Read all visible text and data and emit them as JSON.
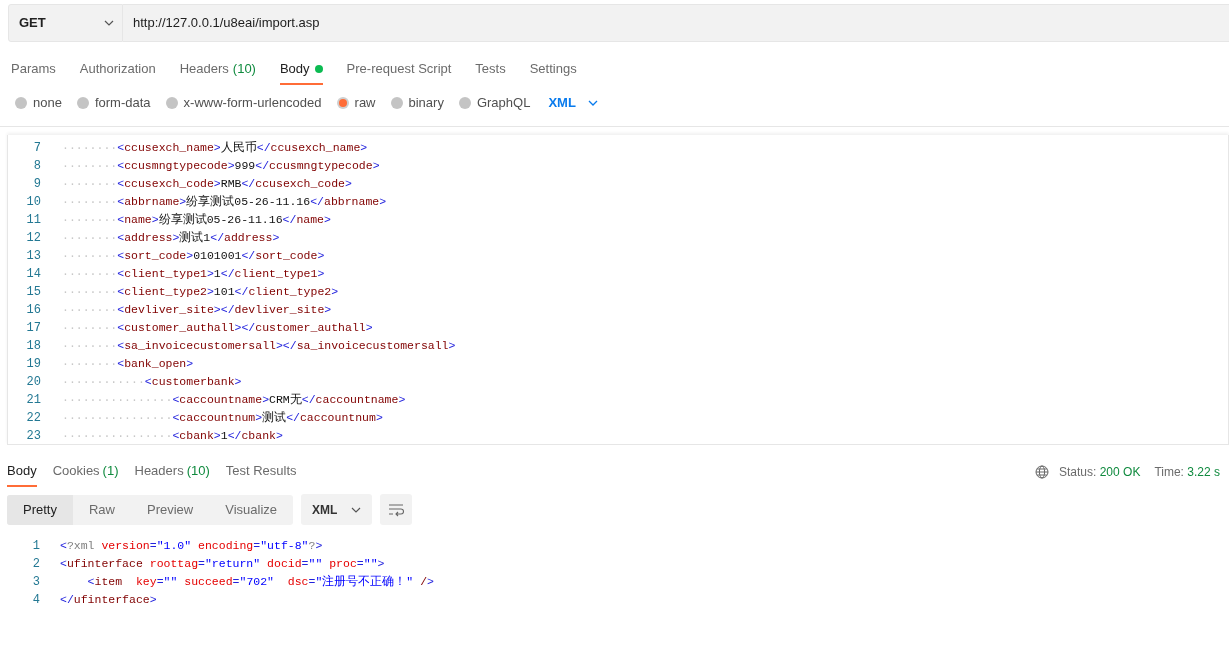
{
  "request": {
    "method": "GET",
    "url": "http://127.0.0.1/u8eai/import.asp"
  },
  "request_tabs": [
    {
      "label": "Params",
      "selected": false
    },
    {
      "label": "Authorization",
      "selected": false
    },
    {
      "label": "Headers",
      "count": "(10)",
      "selected": false
    },
    {
      "label": "Body",
      "dot": true,
      "selected": true
    },
    {
      "label": "Pre-request Script",
      "selected": false
    },
    {
      "label": "Tests",
      "selected": false
    },
    {
      "label": "Settings",
      "selected": false
    }
  ],
  "body_types": [
    {
      "label": "none",
      "selected": false
    },
    {
      "label": "form-data",
      "selected": false
    },
    {
      "label": "x-www-form-urlencoded",
      "selected": false
    },
    {
      "label": "raw",
      "selected": true
    },
    {
      "label": "binary",
      "selected": false
    },
    {
      "label": "GraphQL",
      "selected": false
    }
  ],
  "body_format": "XML",
  "request_body_lines": [
    {
      "number": "7",
      "indent": "········",
      "tokens": [
        {
          "kind": "punct",
          "text": "<"
        },
        {
          "kind": "name",
          "text": "ccusexch_name"
        },
        {
          "kind": "punct",
          "text": ">"
        },
        {
          "kind": "text",
          "text": "人民币"
        },
        {
          "kind": "punct",
          "text": "</"
        },
        {
          "kind": "name",
          "text": "ccusexch_name"
        },
        {
          "kind": "punct",
          "text": ">"
        }
      ]
    },
    {
      "number": "8",
      "indent": "········",
      "tokens": [
        {
          "kind": "punct",
          "text": "<"
        },
        {
          "kind": "name",
          "text": "ccusmngtypecode"
        },
        {
          "kind": "punct",
          "text": ">"
        },
        {
          "kind": "text",
          "text": "999"
        },
        {
          "kind": "punct",
          "text": "</"
        },
        {
          "kind": "name",
          "text": "ccusmngtypecode"
        },
        {
          "kind": "punct",
          "text": ">"
        }
      ]
    },
    {
      "number": "9",
      "indent": "········",
      "tokens": [
        {
          "kind": "punct",
          "text": "<"
        },
        {
          "kind": "name",
          "text": "ccusexch_code"
        },
        {
          "kind": "punct",
          "text": ">"
        },
        {
          "kind": "text",
          "text": "RMB"
        },
        {
          "kind": "punct",
          "text": "</"
        },
        {
          "kind": "name",
          "text": "ccusexch_code"
        },
        {
          "kind": "punct",
          "text": ">"
        }
      ]
    },
    {
      "number": "10",
      "indent": "········",
      "tokens": [
        {
          "kind": "punct",
          "text": "<"
        },
        {
          "kind": "name",
          "text": "abbrname"
        },
        {
          "kind": "punct",
          "text": ">"
        },
        {
          "kind": "text",
          "text": "纷享测试05-26-11.16"
        },
        {
          "kind": "punct",
          "text": "</"
        },
        {
          "kind": "name",
          "text": "abbrname"
        },
        {
          "kind": "punct",
          "text": ">"
        }
      ]
    },
    {
      "number": "11",
      "indent": "········",
      "tokens": [
        {
          "kind": "punct",
          "text": "<"
        },
        {
          "kind": "name",
          "text": "name"
        },
        {
          "kind": "punct",
          "text": ">"
        },
        {
          "kind": "text",
          "text": "纷享测试05-26-11.16"
        },
        {
          "kind": "punct",
          "text": "</"
        },
        {
          "kind": "name",
          "text": "name"
        },
        {
          "kind": "punct",
          "text": ">"
        }
      ]
    },
    {
      "number": "12",
      "indent": "········",
      "tokens": [
        {
          "kind": "punct",
          "text": "<"
        },
        {
          "kind": "name",
          "text": "address"
        },
        {
          "kind": "punct",
          "text": ">"
        },
        {
          "kind": "text",
          "text": "测试1"
        },
        {
          "kind": "punct",
          "text": "</"
        },
        {
          "kind": "name",
          "text": "address"
        },
        {
          "kind": "punct",
          "text": ">"
        }
      ]
    },
    {
      "number": "13",
      "indent": "········",
      "tokens": [
        {
          "kind": "punct",
          "text": "<"
        },
        {
          "kind": "name",
          "text": "sort_code"
        },
        {
          "kind": "punct",
          "text": ">"
        },
        {
          "kind": "text",
          "text": "0101001"
        },
        {
          "kind": "punct",
          "text": "</"
        },
        {
          "kind": "name",
          "text": "sort_code"
        },
        {
          "kind": "punct",
          "text": ">"
        }
      ]
    },
    {
      "number": "14",
      "indent": "········",
      "tokens": [
        {
          "kind": "punct",
          "text": "<"
        },
        {
          "kind": "name",
          "text": "client_type1"
        },
        {
          "kind": "punct",
          "text": ">"
        },
        {
          "kind": "text",
          "text": "1"
        },
        {
          "kind": "punct",
          "text": "</"
        },
        {
          "kind": "name",
          "text": "client_type1"
        },
        {
          "kind": "punct",
          "text": ">"
        }
      ]
    },
    {
      "number": "15",
      "indent": "········",
      "tokens": [
        {
          "kind": "punct",
          "text": "<"
        },
        {
          "kind": "name",
          "text": "client_type2"
        },
        {
          "kind": "punct",
          "text": ">"
        },
        {
          "kind": "text",
          "text": "101"
        },
        {
          "kind": "punct",
          "text": "</"
        },
        {
          "kind": "name",
          "text": "client_type2"
        },
        {
          "kind": "punct",
          "text": ">"
        }
      ]
    },
    {
      "number": "16",
      "indent": "········",
      "tokens": [
        {
          "kind": "punct",
          "text": "<"
        },
        {
          "kind": "name",
          "text": "devliver_site"
        },
        {
          "kind": "punct",
          "text": "></"
        },
        {
          "kind": "name",
          "text": "devliver_site"
        },
        {
          "kind": "punct",
          "text": ">"
        }
      ]
    },
    {
      "number": "17",
      "indent": "········",
      "tokens": [
        {
          "kind": "punct",
          "text": "<"
        },
        {
          "kind": "name",
          "text": "customer_authall"
        },
        {
          "kind": "punct",
          "text": "></"
        },
        {
          "kind": "name",
          "text": "customer_authall"
        },
        {
          "kind": "punct",
          "text": ">"
        }
      ]
    },
    {
      "number": "18",
      "indent": "········",
      "tokens": [
        {
          "kind": "punct",
          "text": "<"
        },
        {
          "kind": "name",
          "text": "sa_invoicecustomersall"
        },
        {
          "kind": "punct",
          "text": "></"
        },
        {
          "kind": "name",
          "text": "sa_invoicecustomersall"
        },
        {
          "kind": "punct",
          "text": ">"
        }
      ]
    },
    {
      "number": "19",
      "indent": "········",
      "tokens": [
        {
          "kind": "punct",
          "text": "<"
        },
        {
          "kind": "name",
          "text": "bank_open"
        },
        {
          "kind": "punct",
          "text": ">"
        }
      ]
    },
    {
      "number": "20",
      "indent": "············",
      "tokens": [
        {
          "kind": "punct",
          "text": "<"
        },
        {
          "kind": "name",
          "text": "customerbank"
        },
        {
          "kind": "punct",
          "text": ">"
        }
      ]
    },
    {
      "number": "21",
      "indent": "················",
      "tokens": [
        {
          "kind": "punct",
          "text": "<"
        },
        {
          "kind": "name",
          "text": "caccountname"
        },
        {
          "kind": "punct",
          "text": ">"
        },
        {
          "kind": "text",
          "text": "CRM无"
        },
        {
          "kind": "punct",
          "text": "</"
        },
        {
          "kind": "name",
          "text": "caccountname"
        },
        {
          "kind": "punct",
          "text": ">"
        }
      ]
    },
    {
      "number": "22",
      "indent": "················",
      "tokens": [
        {
          "kind": "punct",
          "text": "<"
        },
        {
          "kind": "name",
          "text": "caccountnum"
        },
        {
          "kind": "punct",
          "text": ">"
        },
        {
          "kind": "text",
          "text": "测试"
        },
        {
          "kind": "punct",
          "text": "</"
        },
        {
          "kind": "name",
          "text": "caccountnum"
        },
        {
          "kind": "punct",
          "text": ">"
        }
      ]
    },
    {
      "number": "23",
      "indent": "················",
      "tokens": [
        {
          "kind": "punct",
          "text": "<"
        },
        {
          "kind": "name",
          "text": "cbank"
        },
        {
          "kind": "punct",
          "text": ">"
        },
        {
          "kind": "text",
          "text": "1"
        },
        {
          "kind": "punct",
          "text": "</"
        },
        {
          "kind": "name",
          "text": "cbank"
        },
        {
          "kind": "punct",
          "text": ">"
        }
      ]
    }
  ],
  "response_tabs": [
    {
      "label": "Body",
      "selected": true
    },
    {
      "label": "Cookies",
      "count": "(1)",
      "selected": false
    },
    {
      "label": "Headers",
      "count": "(10)",
      "selected": false
    },
    {
      "label": "Test Results",
      "selected": false
    }
  ],
  "response_status": {
    "status_label": "Status:",
    "status": "200 OK",
    "time_label": "Time:",
    "time": "3.22 s"
  },
  "view_modes": [
    {
      "label": "Pretty",
      "selected": true
    },
    {
      "label": "Raw",
      "selected": false
    },
    {
      "label": "Preview",
      "selected": false
    },
    {
      "label": "Visualize",
      "selected": false
    }
  ],
  "response_format": "XML",
  "response_body_lines": [
    {
      "number": "1",
      "tokens": [
        {
          "kind": "punct",
          "text": "<"
        },
        {
          "kind": "decl",
          "text": "?xml"
        },
        {
          "kind": "attr",
          "text": " version"
        },
        {
          "kind": "punct",
          "text": "="
        },
        {
          "kind": "value",
          "text": "\"1.0\""
        },
        {
          "kind": "attr",
          "text": " encoding"
        },
        {
          "kind": "punct",
          "text": "="
        },
        {
          "kind": "value",
          "text": "\"utf-8\""
        },
        {
          "kind": "decl",
          "text": "?"
        },
        {
          "kind": "punct",
          "text": ">"
        }
      ]
    },
    {
      "number": "2",
      "tokens": [
        {
          "kind": "punct",
          "text": "<"
        },
        {
          "kind": "name",
          "text": "ufinterface"
        },
        {
          "kind": "attr",
          "text": " roottag"
        },
        {
          "kind": "punct",
          "text": "="
        },
        {
          "kind": "value",
          "text": "\"return\""
        },
        {
          "kind": "attr",
          "text": " docid"
        },
        {
          "kind": "punct",
          "text": "="
        },
        {
          "kind": "value",
          "text": "\"\""
        },
        {
          "kind": "attr",
          "text": " proc"
        },
        {
          "kind": "punct",
          "text": "="
        },
        {
          "kind": "value",
          "text": "\"\""
        },
        {
          "kind": "punct",
          "text": ">"
        }
      ]
    },
    {
      "number": "3",
      "tokens": [
        {
          "kind": "punct",
          "text": "    <"
        },
        {
          "kind": "name",
          "text": "item"
        },
        {
          "kind": "attr",
          "text": "  key"
        },
        {
          "kind": "punct",
          "text": "="
        },
        {
          "kind": "value",
          "text": "\"\""
        },
        {
          "kind": "attr",
          "text": " succeed"
        },
        {
          "kind": "punct",
          "text": "="
        },
        {
          "kind": "value",
          "text": "\"702\""
        },
        {
          "kind": "attr",
          "text": "  dsc"
        },
        {
          "kind": "punct",
          "text": "="
        },
        {
          "kind": "value",
          "text": "\"注册号不正确！\""
        },
        {
          "kind": "name",
          "text": " /"
        },
        {
          "kind": "punct",
          "text": ">"
        }
      ]
    },
    {
      "number": "4",
      "tokens": [
        {
          "kind": "punct",
          "text": "</"
        },
        {
          "kind": "name",
          "text": "ufinterface"
        },
        {
          "kind": "punct",
          "text": ">"
        }
      ]
    }
  ]
}
